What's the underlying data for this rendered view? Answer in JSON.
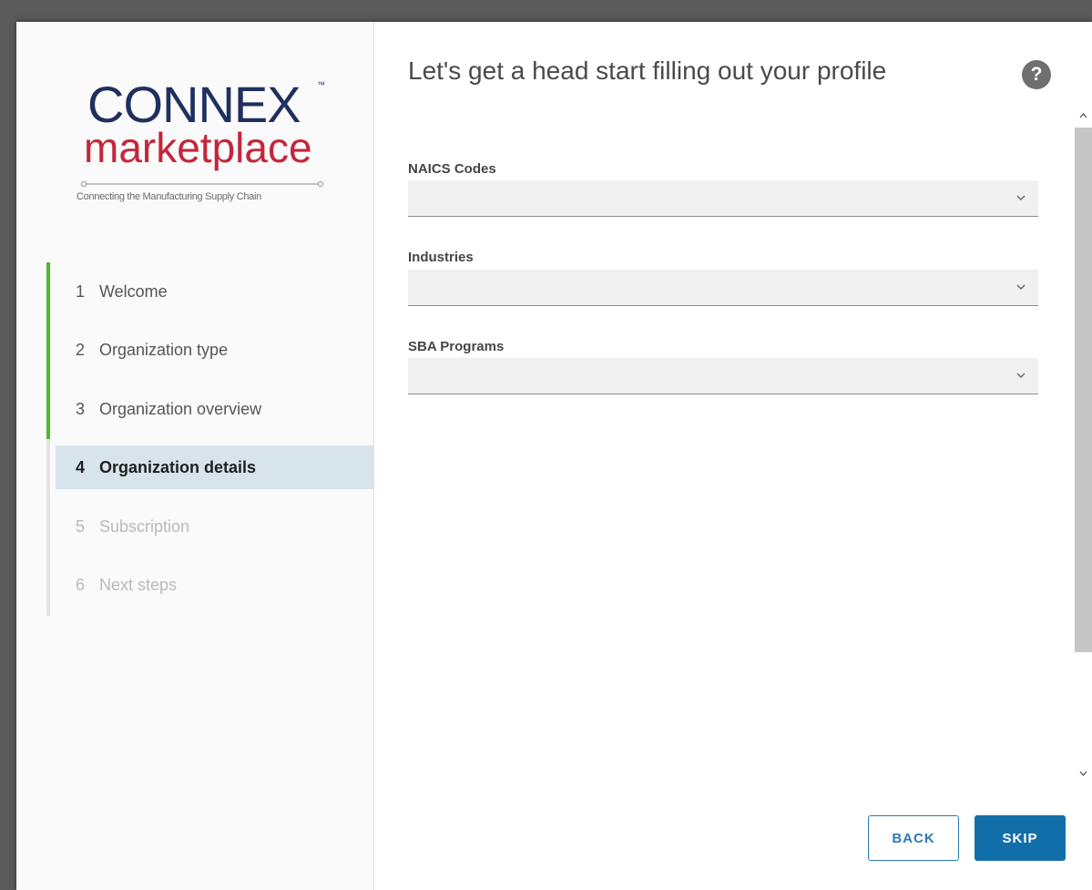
{
  "logo": {
    "brand": "CONNEX",
    "trademark": "™",
    "subbrand": "marketplace",
    "tagline": "Connecting the Manufacturing Supply Chain"
  },
  "steps": [
    {
      "num": "1",
      "label": "Welcome",
      "state": "completed"
    },
    {
      "num": "2",
      "label": "Organization type",
      "state": "completed"
    },
    {
      "num": "3",
      "label": "Organization overview",
      "state": "completed"
    },
    {
      "num": "4",
      "label": "Organization details",
      "state": "active"
    },
    {
      "num": "5",
      "label": "Subscription",
      "state": "disabled"
    },
    {
      "num": "6",
      "label": "Next steps",
      "state": "disabled"
    }
  ],
  "main": {
    "title": "Let's get a head start filling out your profile",
    "help_icon": "?",
    "fields": [
      {
        "label": "NAICS Codes",
        "value": ""
      },
      {
        "label": "Industries",
        "value": ""
      },
      {
        "label": "SBA Programs",
        "value": ""
      }
    ]
  },
  "buttons": {
    "back": "BACK",
    "skip": "SKIP"
  },
  "colors": {
    "progress": "#4fb830",
    "active_step_bg": "#d8e4ec",
    "primary": "#126ea8",
    "logo_navy": "#1f2f5e",
    "logo_red": "#c4263a"
  }
}
